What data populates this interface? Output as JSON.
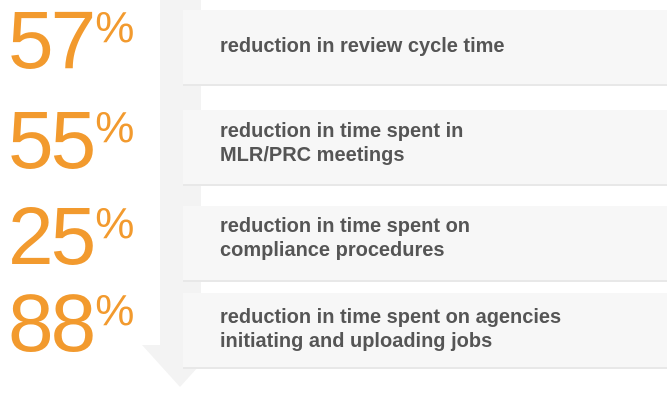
{
  "stats": [
    {
      "value": "57",
      "unit": "%",
      "lines": [
        "reduction in review cycle time"
      ]
    },
    {
      "value": "55",
      "unit": "%",
      "lines": [
        "reduction in time spent in",
        "MLR/PRC meetings"
      ]
    },
    {
      "value": "25",
      "unit": "%",
      "lines": [
        "reduction in time spent on",
        "compliance procedures"
      ]
    },
    {
      "value": "88",
      "unit": "%",
      "lines": [
        "reduction in time spent on agencies",
        "initiating and uploading jobs"
      ]
    }
  ],
  "colors": {
    "accent": "#f29a2e",
    "text": "#555555",
    "band": "#f7f7f7",
    "arrow": "#f3f3f3"
  },
  "icons": {
    "arrow": "down-arrow-icon"
  }
}
